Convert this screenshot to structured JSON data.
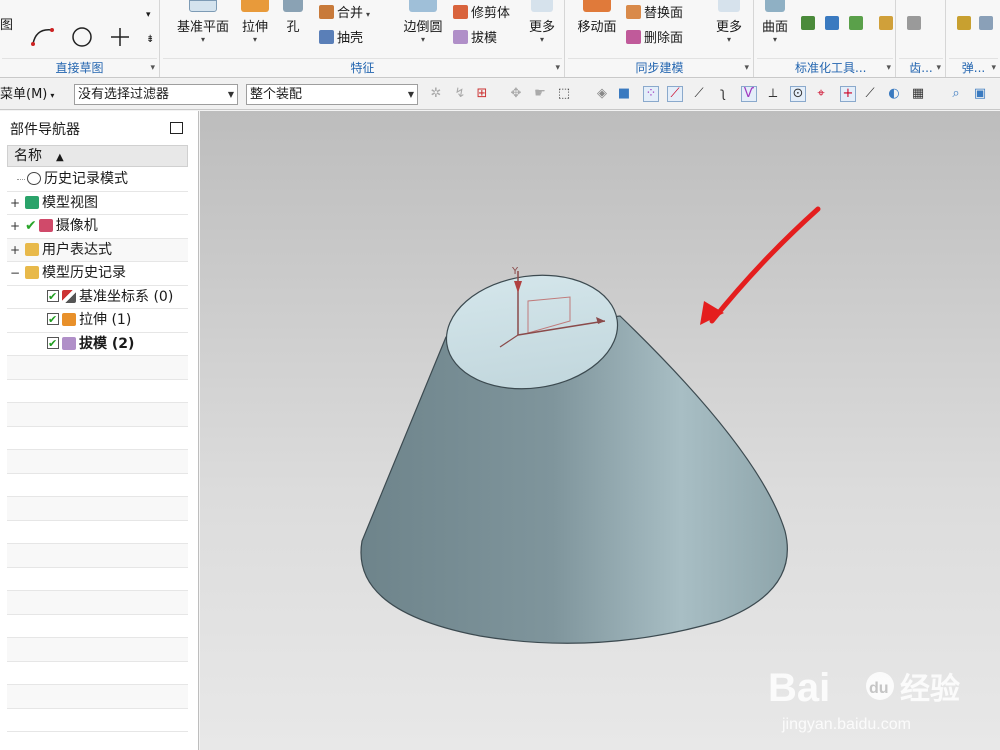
{
  "ribbon": {
    "group_direct_sketch": {
      "label": "直接草图",
      "partial_label": "图"
    },
    "group_feature": {
      "label": "特征",
      "datum_plane": "基准平面",
      "extrude": "拉伸",
      "hole": "孔",
      "unite": "合并",
      "shell": "抽壳",
      "edge_blend": "边倒圆",
      "trim_body": "修剪体",
      "draft": "拔模",
      "more": "更多"
    },
    "group_sync": {
      "label": "同步建模",
      "move_face": "移动面",
      "replace_face": "替换面",
      "delete_face": "删除面",
      "more": "更多"
    },
    "group_surface": {
      "curved_surface": "曲面"
    },
    "group_standard_tools": {
      "label": "标准化工具..."
    },
    "group_gear": {
      "label": "齿..."
    },
    "group_spring": {
      "label": "弹..."
    }
  },
  "toolbar": {
    "menu_label": "菜单(M)",
    "filter_value": "没有选择过滤器",
    "assembly_value": "整个装配"
  },
  "navigator": {
    "title": "部件导航器",
    "column_name": "名称",
    "items": [
      {
        "label": "历史记录模式"
      },
      {
        "label": "模型视图"
      },
      {
        "label": "摄像机"
      },
      {
        "label": "用户表达式"
      },
      {
        "label": "模型历史记录"
      },
      {
        "label": "基准坐标系 (0)"
      },
      {
        "label": "拉伸 (1)"
      },
      {
        "label": "拔模 (2)"
      }
    ]
  },
  "viewport": {
    "axis_y": "Y",
    "watermark_brand": "Bai",
    "watermark_cn": "经验",
    "watermark_url": "jingyan.baidu.com"
  },
  "colors": {
    "accent": "#2466b0",
    "cone_dark": "#6f858c",
    "cone_light": "#aec3c9",
    "top_face": "#c9dde3",
    "arrow": "#e41e1e"
  }
}
